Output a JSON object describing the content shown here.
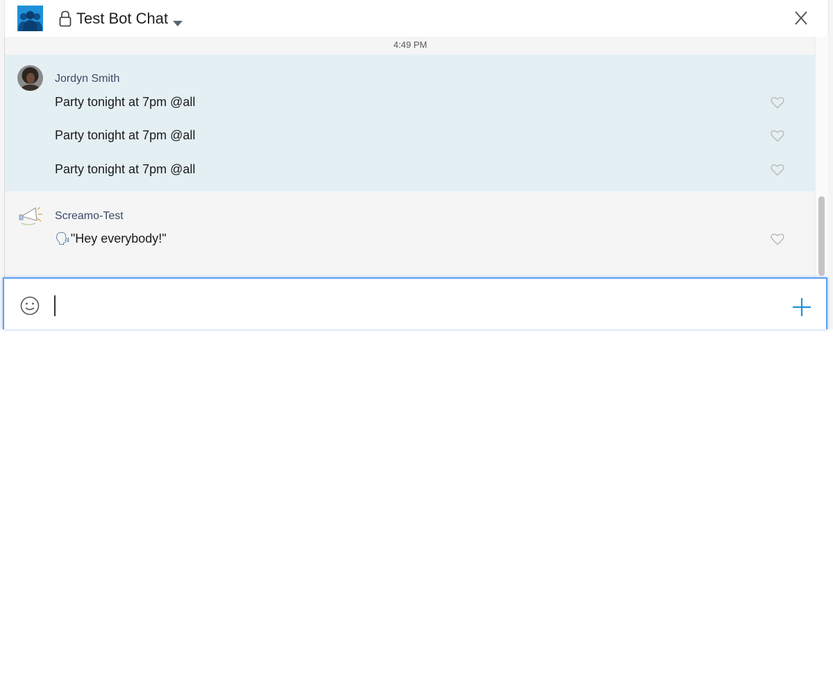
{
  "header": {
    "title": "Test Bot Chat",
    "group_icon": "group-people-icon",
    "lock_icon": "lock-icon",
    "dropdown_icon": "caret-down-icon",
    "close_icon": "close-icon"
  },
  "conversation": {
    "timestamp": "4:49 PM",
    "groups": [
      {
        "sender": "Jordyn Smith",
        "highlighted": true,
        "messages": [
          "Party tonight at 7pm @all",
          "Party tonight at 7pm @all",
          "Party tonight at 7pm @all"
        ]
      },
      {
        "sender": "Screamo-Test",
        "highlighted": false,
        "messages": [
          "\"Hey everybody!\""
        ],
        "emoji": "🗣"
      }
    ]
  },
  "composer": {
    "value": "",
    "placeholder": "",
    "emoji_icon": "smiley-icon",
    "attach_icon": "plus-icon"
  },
  "colors": {
    "accent": "#1e90d8",
    "highlight_bg": "#e4eff4",
    "focus_border": "#5b9ff0",
    "sender_text": "#3a4a66"
  }
}
